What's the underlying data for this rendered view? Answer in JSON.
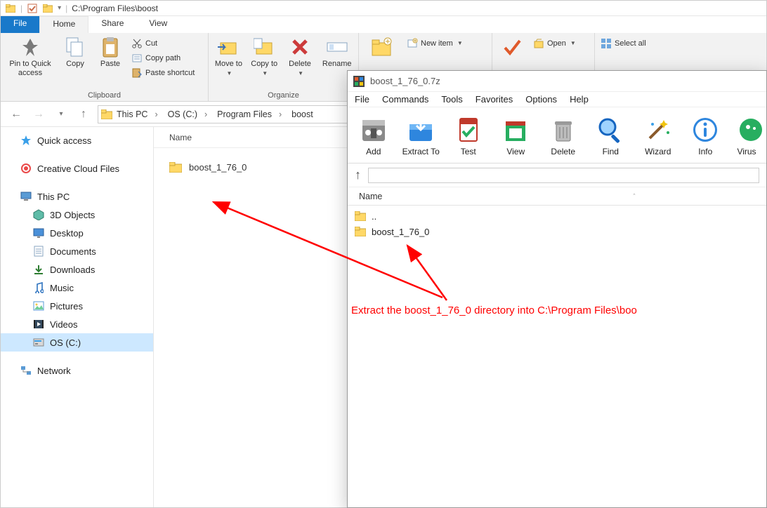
{
  "explorer": {
    "title_path": "C:\\Program Files\\boost",
    "tabs": {
      "file": "File",
      "home": "Home",
      "share": "Share",
      "view": "View"
    },
    "ribbon": {
      "pin": "Pin to Quick access",
      "copy": "Copy",
      "paste": "Paste",
      "cut": "Cut",
      "copy_path": "Copy path",
      "paste_shortcut": "Paste shortcut",
      "clipboard_group": "Clipboard",
      "move_to": "Move to",
      "copy_to": "Copy to",
      "delete": "Delete",
      "rename": "Rename",
      "organize_group": "Organize",
      "new_item": "New item",
      "open": "Open",
      "select_all": "Select all"
    },
    "breadcrumbs": [
      "This PC",
      "OS (C:)",
      "Program Files",
      "boost"
    ],
    "columns": {
      "name": "Name"
    },
    "files": [
      {
        "name": "boost_1_76_0",
        "type": "folder"
      }
    ],
    "sidebar": {
      "quick_access": "Quick access",
      "creative_cloud": "Creative Cloud Files",
      "this_pc": "This PC",
      "children": [
        "3D Objects",
        "Desktop",
        "Documents",
        "Downloads",
        "Music",
        "Pictures",
        "Videos",
        "OS (C:)"
      ],
      "network": "Network"
    }
  },
  "sevenzip": {
    "title": "boost_1_76_0.7z",
    "menu": [
      "File",
      "Commands",
      "Tools",
      "Favorites",
      "Options",
      "Help"
    ],
    "toolbar": [
      "Add",
      "Extract To",
      "Test",
      "View",
      "Delete",
      "Find",
      "Wizard",
      "Info",
      "Virus"
    ],
    "columns": {
      "name": "Name"
    },
    "rows": [
      {
        "name": "..",
        "type": "up"
      },
      {
        "name": "boost_1_76_0",
        "type": "folder"
      }
    ]
  },
  "annotation": {
    "text": "Extract the boost_1_76_0 directory into C:\\Program Files\\boo"
  }
}
